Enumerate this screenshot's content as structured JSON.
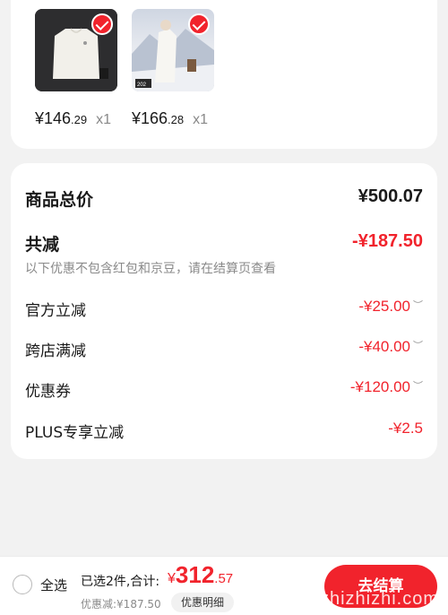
{
  "products": [
    {
      "price_int": "¥146",
      "price_dec": ".29",
      "qty": "x1",
      "selected": true,
      "image_desc_color": "#2d2d2f"
    },
    {
      "price_int": "¥166",
      "price_dec": ".28",
      "qty": "x1",
      "selected": true,
      "image_desc_color": "#dfe4ec"
    }
  ],
  "summary": {
    "goods_total_label": "商品总价",
    "goods_total_value": "¥500.07",
    "total_discount_label": "共减",
    "total_discount_value": "-¥187.50",
    "discount_note": "以下优惠不包含红包和京豆，请在结算页查看",
    "items": [
      {
        "label": "官方立减",
        "value": "-¥25.00",
        "expandable": true
      },
      {
        "label": "跨店满减",
        "value": "-¥40.00",
        "expandable": true
      },
      {
        "label": "优惠券",
        "value": "-¥120.00",
        "expandable": true
      },
      {
        "label": "PLUS专享立减",
        "value": "-¥2.5",
        "expandable": false
      }
    ]
  },
  "bottom_bar": {
    "select_all_label": "全选",
    "selected_count_label": "已选2件,合计:",
    "total_currency": "¥",
    "total_int": "312",
    "total_dec": ".57",
    "discount_text": "优惠减:¥187.50",
    "detail_button": "优惠明细",
    "checkout_button": "去结算"
  },
  "watermark": {
    "text": "zhizhizhi.com"
  },
  "colors": {
    "accent": "#f1232c",
    "background": "#f2f2f2"
  }
}
